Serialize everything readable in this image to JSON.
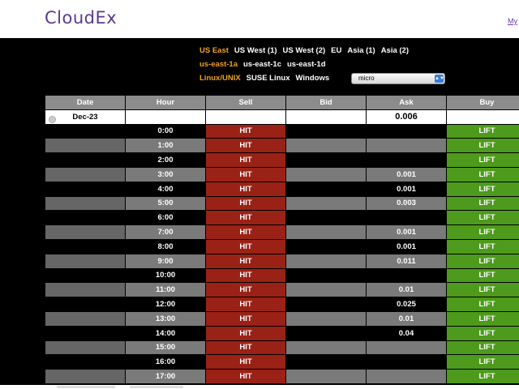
{
  "app": {
    "logo": "CloudEx",
    "my_link": "My"
  },
  "filters": {
    "regions": [
      {
        "label": "US East",
        "active": true
      },
      {
        "label": "US West (1)",
        "active": false
      },
      {
        "label": "US West (2)",
        "active": false
      },
      {
        "label": "EU",
        "active": false
      },
      {
        "label": "Asia (1)",
        "active": false
      },
      {
        "label": "Asia (2)",
        "active": false
      }
    ],
    "zones": [
      {
        "label": "us-east-1a",
        "active": true
      },
      {
        "label": "us-east-1c",
        "active": false
      },
      {
        "label": "us-east-1d",
        "active": false
      }
    ],
    "os": [
      {
        "label": "Linux/UNIX",
        "active": true
      },
      {
        "label": "SUSE Linux",
        "active": false
      },
      {
        "label": "Windows",
        "active": false
      }
    ],
    "instance_type": "micro"
  },
  "table": {
    "headers": {
      "date": "Date",
      "hour": "Hour",
      "sell": "Sell",
      "bid": "Bid",
      "ask": "Ask",
      "buy": "Buy"
    },
    "date_row": {
      "date": "Dec-23",
      "ask": "0.006"
    },
    "rows": [
      {
        "hour": "0:00",
        "sell": "HIT",
        "bid": "",
        "ask": "",
        "buy": "LIFT"
      },
      {
        "hour": "1:00",
        "sell": "HIT",
        "bid": "",
        "ask": "",
        "buy": "LIFT"
      },
      {
        "hour": "2:00",
        "sell": "HIT",
        "bid": "",
        "ask": "",
        "buy": "LIFT"
      },
      {
        "hour": "3:00",
        "sell": "HIT",
        "bid": "",
        "ask": "0.001",
        "buy": "LIFT"
      },
      {
        "hour": "4:00",
        "sell": "HIT",
        "bid": "",
        "ask": "0.001",
        "buy": "LIFT"
      },
      {
        "hour": "5:00",
        "sell": "HIT",
        "bid": "",
        "ask": "0.003",
        "buy": "LIFT"
      },
      {
        "hour": "6:00",
        "sell": "HIT",
        "bid": "",
        "ask": "",
        "buy": "LIFT"
      },
      {
        "hour": "7:00",
        "sell": "HIT",
        "bid": "",
        "ask": "0.001",
        "buy": "LIFT"
      },
      {
        "hour": "8:00",
        "sell": "HIT",
        "bid": "",
        "ask": "0.001",
        "buy": "LIFT"
      },
      {
        "hour": "9:00",
        "sell": "HIT",
        "bid": "",
        "ask": "0.011",
        "buy": "LIFT"
      },
      {
        "hour": "10:00",
        "sell": "HIT",
        "bid": "",
        "ask": "",
        "buy": "LIFT"
      },
      {
        "hour": "11:00",
        "sell": "HIT",
        "bid": "",
        "ask": "0.01",
        "buy": "LIFT"
      },
      {
        "hour": "12:00",
        "sell": "HIT",
        "bid": "",
        "ask": "0.025",
        "buy": "LIFT"
      },
      {
        "hour": "13:00",
        "sell": "HIT",
        "bid": "",
        "ask": "0.01",
        "buy": "LIFT"
      },
      {
        "hour": "14:00",
        "sell": "HIT",
        "bid": "",
        "ask": "0.04",
        "buy": "LIFT"
      },
      {
        "hour": "15:00",
        "sell": "HIT",
        "bid": "",
        "ask": "",
        "buy": "LIFT"
      },
      {
        "hour": "16:00",
        "sell": "HIT",
        "bid": "",
        "ask": "",
        "buy": "LIFT"
      },
      {
        "hour": "17:00",
        "sell": "HIT",
        "bid": "",
        "ask": "",
        "buy": "LIFT"
      }
    ]
  },
  "colors": {
    "sell": "#9a2116",
    "buy": "#4e9a1c",
    "active_filter": "#f0a020",
    "logo": "#5b3a8f"
  }
}
